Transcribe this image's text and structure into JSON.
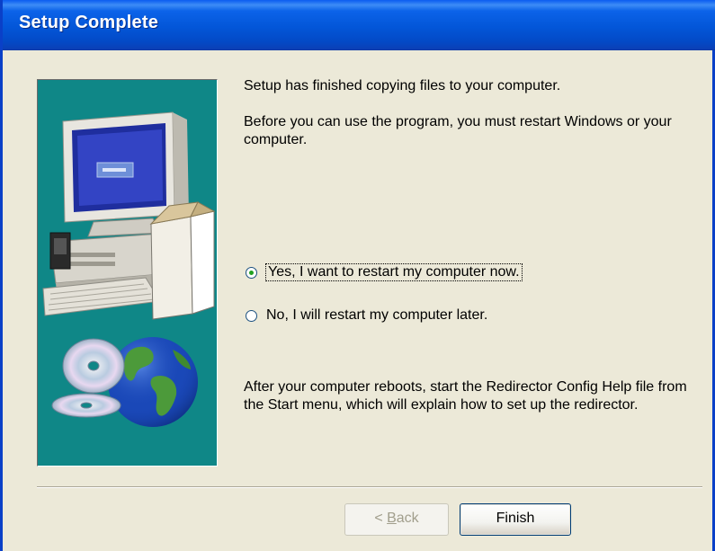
{
  "window": {
    "title": "Setup Complete"
  },
  "art": {
    "icon": "computer-with-globe-and-cd-illustration",
    "background": "#0F8787"
  },
  "content": {
    "intro": "Setup has finished copying files to your computer.",
    "restart_note": "Before you can use the program, you must restart Windows or your computer.",
    "options": [
      {
        "label": "Yes, I want to restart my computer now.",
        "selected": true
      },
      {
        "label": "No, I will restart my computer later.",
        "selected": false
      }
    ],
    "after_note": "After your computer reboots, start the Redirector Config Help file from the Start menu, which will explain how to set up the redirector."
  },
  "buttons": {
    "back_prefix": "< ",
    "back_key": "B",
    "back_rest": "ack",
    "finish": "Finish",
    "back_enabled": false
  },
  "colors": {
    "title_bar": "#0A5CF0",
    "dialog_bg": "#ECE9D8",
    "radio_dot": "#21A121"
  }
}
